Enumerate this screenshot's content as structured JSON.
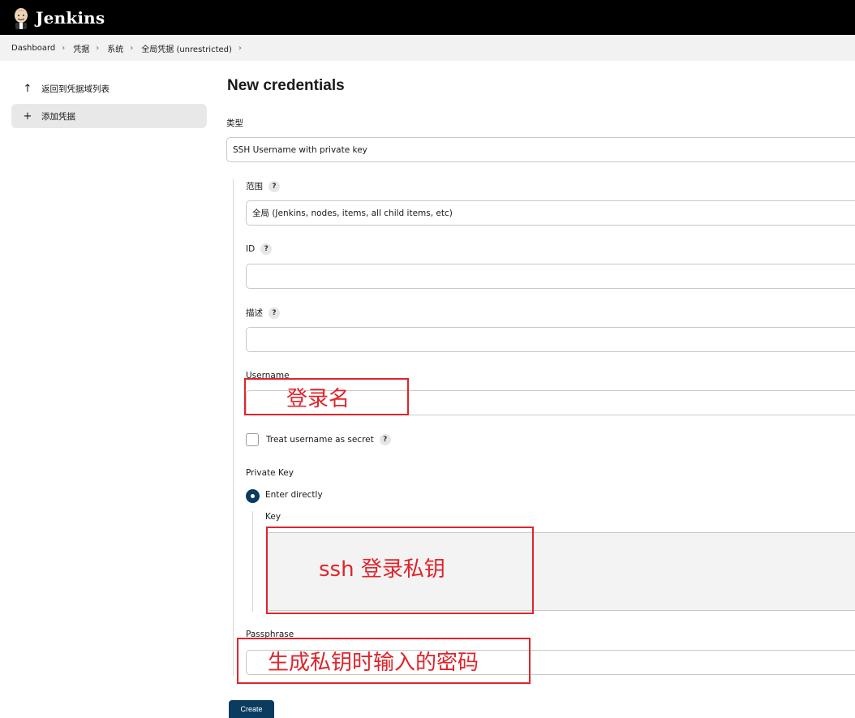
{
  "app": {
    "brand": "Jenkins",
    "logo_icon": "jenkins-butler-icon"
  },
  "breadcrumbs": [
    "Dashboard",
    "凭据",
    "系统",
    "全局凭据 (unrestricted)"
  ],
  "sidebar": {
    "items": [
      {
        "label": "返回到凭据域列表",
        "icon": "arrow-up-icon"
      },
      {
        "label": "添加凭据",
        "icon": "plus-icon",
        "active": true
      }
    ]
  },
  "page": {
    "title": "New credentials"
  },
  "form": {
    "kind_label": "类型",
    "kind_value": "SSH Username with private key",
    "scope_label": "范围",
    "scope_value": "全局 (Jenkins, nodes, items, all child items, etc)",
    "id_label": "ID",
    "id_value": "",
    "description_label": "描述",
    "description_value": "",
    "username_label": "Username",
    "username_value": "",
    "treat_secret_label": "Treat username as secret",
    "treat_secret_checked": false,
    "private_key_label": "Private Key",
    "enter_directly_label": "Enter directly",
    "key_label": "Key",
    "key_value": "",
    "passphrase_label": "Passphrase",
    "passphrase_value": "",
    "help_glyph": "?",
    "create_label": "Create"
  },
  "annotations": {
    "username_note": "登录名",
    "key_note": "ssh 登录私钥",
    "passphrase_note": "生成私钥时输入的密码",
    "color": "#e0242b"
  },
  "colors": {
    "primary": "#0b3b5e",
    "topbar": "#000000",
    "breadcrumb_bg": "#f2f2f2"
  }
}
